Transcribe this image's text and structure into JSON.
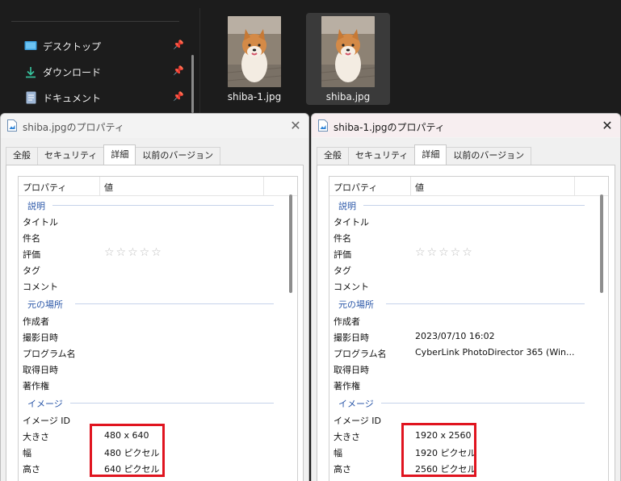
{
  "explorer": {
    "nav_items": [
      {
        "label": "デスクトップ",
        "icon": "desktop-icon",
        "pinned": true
      },
      {
        "label": "ダウンロード",
        "icon": "download-icon",
        "pinned": true
      },
      {
        "label": "ドキュメント",
        "icon": "document-icon",
        "pinned": true
      }
    ],
    "files": [
      {
        "name": "shiba-1.jpg",
        "selected": false
      },
      {
        "name": "shiba.jpg",
        "selected": true
      }
    ]
  },
  "dialog_left": {
    "title": "shiba.jpgのプロパティ",
    "tabs": [
      "全般",
      "セキュリティ",
      "詳細",
      "以前のバージョン"
    ],
    "active_tab": "詳細",
    "columns": {
      "property": "プロパティ",
      "value": "値"
    },
    "groups": {
      "description": "説明",
      "origin": "元の場所",
      "image": "イメージ"
    },
    "rows": {
      "title": {
        "name": "タイトル",
        "value": ""
      },
      "subject": {
        "name": "件名",
        "value": ""
      },
      "rating": {
        "name": "評価",
        "value": "☆☆☆☆☆"
      },
      "tags": {
        "name": "タグ",
        "value": ""
      },
      "comments": {
        "name": "コメント",
        "value": ""
      },
      "authors": {
        "name": "作成者",
        "value": ""
      },
      "date_taken": {
        "name": "撮影日時",
        "value": ""
      },
      "program": {
        "name": "プログラム名",
        "value": ""
      },
      "date_acquired": {
        "name": "取得日時",
        "value": ""
      },
      "copyright": {
        "name": "著作権",
        "value": ""
      },
      "image_id": {
        "name": "イメージ ID",
        "value": ""
      },
      "dimensions": {
        "name": "大きさ",
        "value": "480 x 640"
      },
      "width": {
        "name": "幅",
        "value": "480 ピクセル"
      },
      "height": {
        "name": "高さ",
        "value": "640 ピクセル"
      }
    }
  },
  "dialog_right": {
    "title": "shiba-1.jpgのプロパティ",
    "tabs": [
      "全般",
      "セキュリティ",
      "詳細",
      "以前のバージョン"
    ],
    "active_tab": "詳細",
    "columns": {
      "property": "プロパティ",
      "value": "値"
    },
    "groups": {
      "description": "説明",
      "origin": "元の場所",
      "image": "イメージ"
    },
    "rows": {
      "title": {
        "name": "タイトル",
        "value": ""
      },
      "subject": {
        "name": "件名",
        "value": ""
      },
      "rating": {
        "name": "評価",
        "value": "☆☆☆☆☆"
      },
      "tags": {
        "name": "タグ",
        "value": ""
      },
      "comments": {
        "name": "コメント",
        "value": ""
      },
      "authors": {
        "name": "作成者",
        "value": ""
      },
      "date_taken": {
        "name": "撮影日時",
        "value": "2023/07/10 16:02"
      },
      "program": {
        "name": "プログラム名",
        "value": "CyberLink PhotoDirector 365 (Win..."
      },
      "date_acquired": {
        "name": "取得日時",
        "value": ""
      },
      "copyright": {
        "name": "著作権",
        "value": ""
      },
      "image_id": {
        "name": "イメージ ID",
        "value": ""
      },
      "dimensions": {
        "name": "大きさ",
        "value": "1920 x 2560"
      },
      "width": {
        "name": "幅",
        "value": "1920 ピクセル"
      },
      "height": {
        "name": "高さ",
        "value": "2560 ピクセル"
      }
    }
  },
  "colors": {
    "explorer_bg": "#1c1c1c",
    "group_header": "#2b57a8",
    "highlight_box": "#e0141f"
  }
}
